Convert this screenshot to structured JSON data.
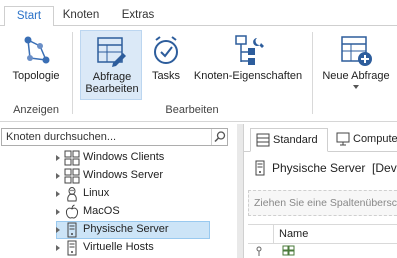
{
  "ribbon_tabs": [
    "Start",
    "Knoten",
    "Extras"
  ],
  "ribbon": {
    "buttons": [
      {
        "label": "Topologie"
      },
      {
        "label": "Abfrage Bearbeiten"
      },
      {
        "label": "Tasks"
      },
      {
        "label": "Knoten-Eigenschaften"
      },
      {
        "label": "Neue Abfrage"
      }
    ],
    "groups": [
      "Anzeigen",
      "Bearbeiten"
    ]
  },
  "colors": {
    "accent": "#2a72c8",
    "selected": "#dbe9f7",
    "tree_selected": "#cce4f7"
  },
  "search": {
    "placeholder": "Knoten durchsuchen..."
  },
  "tree": {
    "items": [
      {
        "label": "Windows Clients",
        "icon": "windows-icon"
      },
      {
        "label": "Windows Server",
        "icon": "windows-icon"
      },
      {
        "label": "Linux",
        "icon": "linux-icon"
      },
      {
        "label": "MacOS",
        "icon": "apple-icon"
      },
      {
        "label": "Physische Server",
        "icon": "server-icon",
        "selected": true
      },
      {
        "label": "Virtuelle Hosts",
        "icon": "server-icon"
      }
    ]
  },
  "right_panel": {
    "tabs": [
      "Standard",
      "Computer"
    ],
    "title": "Physische Server  [Devi",
    "group_hint": "Ziehen Sie eine Spaltenüberschr",
    "columns": [
      "Name"
    ]
  }
}
